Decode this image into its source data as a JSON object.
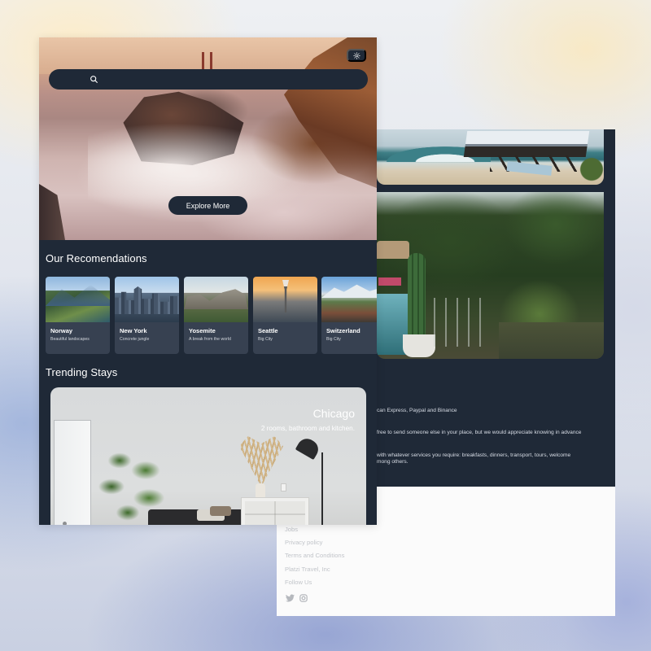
{
  "header": {
    "search_placeholder": "",
    "theme_toggle_icon": "sun-icon",
    "search_icon": "search-icon",
    "explore_label": "Explore More"
  },
  "recommendations": {
    "title": "Our Recomendations",
    "items": [
      {
        "name": "Norway",
        "subtitle": "Beautiful landscapes"
      },
      {
        "name": "New York",
        "subtitle": "Concrete jungle"
      },
      {
        "name": "Yosemite",
        "subtitle": "A break from the world"
      },
      {
        "name": "Seattle",
        "subtitle": "Big City"
      },
      {
        "name": "Switzerland",
        "subtitle": "Big City"
      }
    ]
  },
  "trending": {
    "title": "Trending Stays",
    "stay": {
      "city": "Chicago",
      "description": "2 rooms, bathroom and kitchen."
    }
  },
  "back_page": {
    "info_lines": [
      "can Express, Paypal and Binance",
      "free to send someone else in your place, but we would appreciate knowing in advance",
      "with whatever services you require: breakfasts, dinners, transport, tours, welcome",
      "mong others."
    ],
    "footer_links": [
      "Jobs",
      "Privacy policy",
      "Terms and Conditions",
      "Platzi Travel, Inc",
      "Follow Us"
    ],
    "social_icons": [
      "twitter-icon",
      "instagram-icon"
    ]
  },
  "colors": {
    "page_bg": "#1f2937",
    "card_bg": "#374151",
    "footer_bg": "#fbfbfb",
    "footer_text": "#c2c5ca"
  }
}
